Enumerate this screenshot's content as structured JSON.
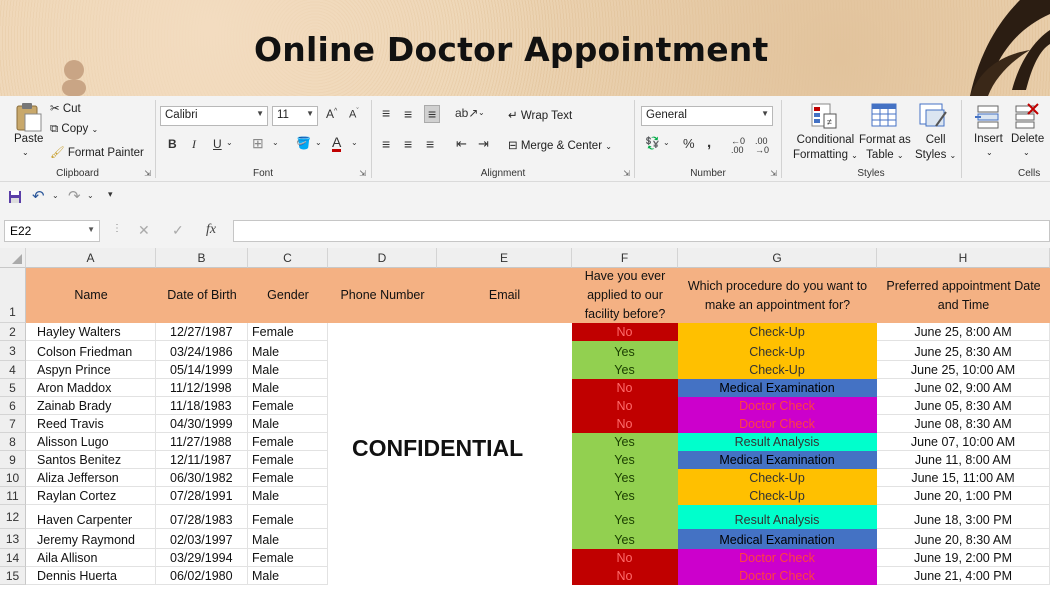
{
  "banner": {
    "title": "Online Doctor Appointment"
  },
  "ribbon": {
    "clipboard": {
      "paste": "Paste",
      "cut": "Cut",
      "copy": "Copy",
      "format_painter": "Format Painter",
      "label": "Clipboard"
    },
    "font": {
      "name": "Calibri",
      "size": "11",
      "bold": "B",
      "italic": "I",
      "underline": "U",
      "label": "Font"
    },
    "alignment": {
      "wrap_text": "Wrap Text",
      "merge_center": "Merge & Center",
      "label": "Alignment"
    },
    "number": {
      "format": "General",
      "percent": "%",
      "comma": ",",
      "label": "Number"
    },
    "styles": {
      "conditional": "Conditional",
      "formatting": "Formatting",
      "format_as": "Format as",
      "table": "Table",
      "cell": "Cell",
      "styles": "Styles",
      "label": "Styles"
    },
    "cells": {
      "insert": "Insert",
      "delete": "Delete",
      "label": "Cells"
    }
  },
  "formula_bar": {
    "name_box": "E22",
    "fx": "fx"
  },
  "columns": [
    "A",
    "B",
    "C",
    "D",
    "E",
    "F",
    "G",
    "H"
  ],
  "headers": {
    "name": "Name",
    "dob": "Date of Birth",
    "gender": "Gender",
    "phone": "Phone Number",
    "email": "Email",
    "applied": "Have you ever applied to our facility before?",
    "procedure": "Which procedure do you want to make an appointment for?",
    "preferred": "Preferred appointment Date and Time"
  },
  "confidential": "CONFIDENTIAL",
  "colors": {
    "header": "#f4b183",
    "no": "#c00000",
    "yes": "#92d050",
    "Check-Up": "#ffc000",
    "Medical Examination": "#4472c4",
    "Doctor Check": "#cc00cc",
    "Result Analysis": "#00ffcc"
  },
  "rows": [
    {
      "num": "2",
      "name": "Hayley Walters",
      "dob": "12/27/1987",
      "gender": "Female",
      "applied": "No",
      "procedure": "Check-Up",
      "preferred": "June 25, 8:00 AM"
    },
    {
      "num": "3",
      "name": "Colson Friedman",
      "dob": "03/24/1986",
      "gender": "Male",
      "applied": "Yes",
      "procedure": "Check-Up",
      "preferred": "June 25, 8:30 AM"
    },
    {
      "num": "4",
      "name": "Aspyn Prince",
      "dob": "05/14/1999",
      "gender": "Male",
      "applied": "Yes",
      "procedure": "Check-Up",
      "preferred": "June 25, 10:00 AM"
    },
    {
      "num": "5",
      "name": "Aron Maddox",
      "dob": "11/12/1998",
      "gender": "Male",
      "applied": "No",
      "procedure": "Medical Examination",
      "preferred": "June 02, 9:00 AM"
    },
    {
      "num": "6",
      "name": "Zainab Brady",
      "dob": "11/18/1983",
      "gender": "Female",
      "applied": "No",
      "procedure": "Doctor Check",
      "preferred": "June 05, 8:30 AM"
    },
    {
      "num": "7",
      "name": "Reed Travis",
      "dob": "04/30/1999",
      "gender": "Male",
      "applied": "No",
      "procedure": "Doctor Check",
      "preferred": "June 08, 8:30 AM"
    },
    {
      "num": "8",
      "name": "Alisson Lugo",
      "dob": "11/27/1988",
      "gender": "Female",
      "applied": "Yes",
      "procedure": "Result Analysis",
      "preferred": "June 07, 10:00 AM"
    },
    {
      "num": "9",
      "name": "Santos Benitez",
      "dob": "12/11/1987",
      "gender": "Female",
      "applied": "Yes",
      "procedure": "Medical Examination",
      "preferred": "June 11, 8:00 AM"
    },
    {
      "num": "10",
      "name": "Aliza Jefferson",
      "dob": "06/30/1982",
      "gender": "Female",
      "applied": "Yes",
      "procedure": "Check-Up",
      "preferred": "June 15, 11:00 AM"
    },
    {
      "num": "11",
      "name": "Raylan Cortez",
      "dob": "07/28/1991",
      "gender": "Male",
      "applied": "Yes",
      "procedure": "Check-Up",
      "preferred": "June 20, 1:00 PM"
    },
    {
      "num": "12",
      "name": "Haven Carpenter",
      "dob": "07/28/1983",
      "gender": "Female",
      "applied": "Yes",
      "procedure": "Result Analysis",
      "preferred": "June 18, 3:00 PM"
    },
    {
      "num": "13",
      "name": "Jeremy Raymond",
      "dob": "02/03/1997",
      "gender": "Male",
      "applied": "Yes",
      "procedure": "Medical Examination",
      "preferred": "June 20, 8:30 AM"
    },
    {
      "num": "14",
      "name": "Aila Allison",
      "dob": "03/29/1994",
      "gender": "Female",
      "applied": "No",
      "procedure": "Doctor Check",
      "preferred": "June 19, 2:00 PM"
    },
    {
      "num": "15",
      "name": "Dennis Huerta",
      "dob": "06/02/1980",
      "gender": "Male",
      "applied": "No",
      "procedure": "Doctor Check",
      "preferred": "June 21, 4:00 PM"
    }
  ]
}
